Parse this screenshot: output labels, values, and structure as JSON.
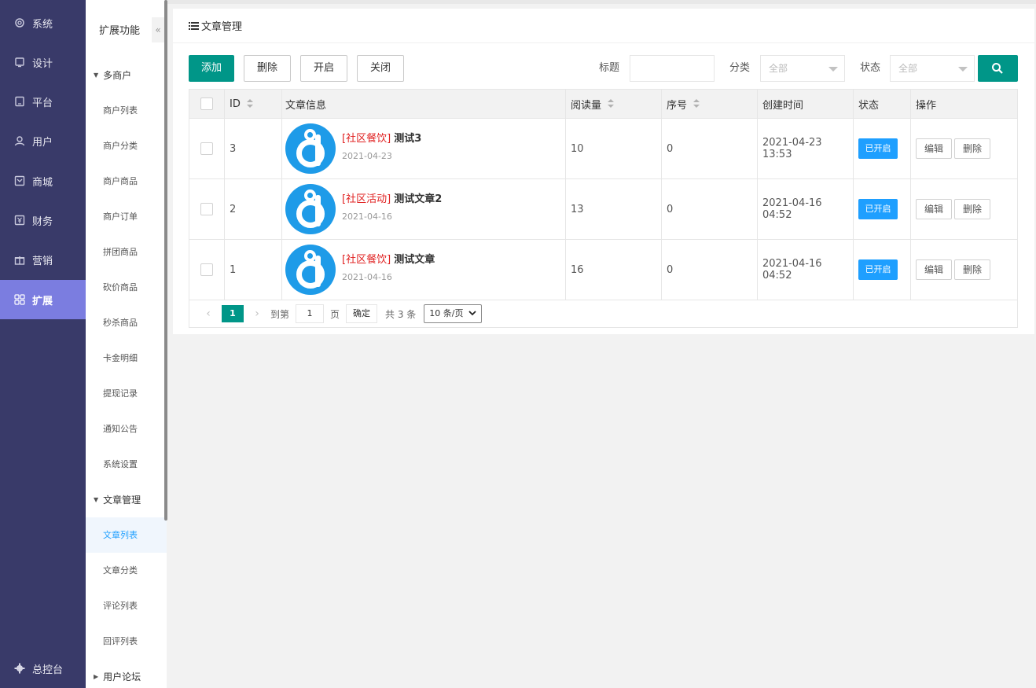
{
  "nav": {
    "items": [
      {
        "label": "系统",
        "icon": "gear-icon"
      },
      {
        "label": "设计",
        "icon": "monitor-icon"
      },
      {
        "label": "平台",
        "icon": "tablet-icon"
      },
      {
        "label": "用户",
        "icon": "user-icon"
      },
      {
        "label": "商城",
        "icon": "store-icon"
      },
      {
        "label": "财务",
        "icon": "yen-icon"
      },
      {
        "label": "营销",
        "icon": "gift-icon"
      },
      {
        "label": "扩展",
        "icon": "grid-icon"
      }
    ],
    "active": "扩展",
    "footer": {
      "label": "总控台",
      "icon": "cog-icon"
    }
  },
  "sidebar": {
    "title": "扩展功能",
    "collapse": "«",
    "groups": [
      {
        "label": "多商户",
        "items": [
          "商户列表",
          "商户分类",
          "商户商品",
          "商户订单",
          "拼团商品",
          "砍价商品",
          "秒杀商品",
          "卡金明细",
          "提现记录",
          "通知公告",
          "系统设置"
        ]
      },
      {
        "label": "文章管理",
        "items": [
          "文章列表",
          "文章分类",
          "评论列表",
          "回评列表"
        ]
      },
      {
        "label": "用户论坛",
        "items": []
      }
    ],
    "active_item": "文章列表"
  },
  "panel": {
    "title": "文章管理",
    "toolbar": {
      "add": "添加",
      "delete": "删除",
      "enable": "开启",
      "close": "关闭",
      "filter_title_label": "标题",
      "filter_title_value": "",
      "filter_category_label": "分类",
      "filter_category_value": "全部",
      "filter_status_label": "状态",
      "filter_status_value": "全部"
    },
    "columns": [
      "ID",
      "文章信息",
      "阅读量",
      "序号",
      "创建时间",
      "状态",
      "操作"
    ],
    "rows": [
      {
        "id": "3",
        "tag": "[社区餐饮]",
        "title": "测试3",
        "date": "2021-04-23",
        "views": "10",
        "order": "0",
        "created": "2021-04-23 13:53",
        "status": "已开启",
        "edit": "编辑",
        "del": "删除"
      },
      {
        "id": "2",
        "tag": "[社区活动]",
        "title": "测试文章2",
        "date": "2021-04-16",
        "views": "13",
        "order": "0",
        "created": "2021-04-16 04:52",
        "status": "已开启",
        "edit": "编辑",
        "del": "删除"
      },
      {
        "id": "1",
        "tag": "[社区餐饮]",
        "title": "测试文章",
        "date": "2021-04-16",
        "views": "16",
        "order": "0",
        "created": "2021-04-16 04:52",
        "status": "已开启",
        "edit": "编辑",
        "del": "删除"
      }
    ],
    "pager": {
      "prev": "‹",
      "current": "1",
      "next": "›",
      "goto_label": "到第",
      "goto_value": "1",
      "page_unit": "页",
      "confirm": "确定",
      "total": "共 3 条",
      "page_size": "10 条/页"
    }
  },
  "colors": {
    "nav_bg": "#393a69",
    "nav_active": "#7b7de0",
    "primary": "#009688",
    "status_blue": "#1e9fff",
    "tag_red": "#e02020"
  }
}
